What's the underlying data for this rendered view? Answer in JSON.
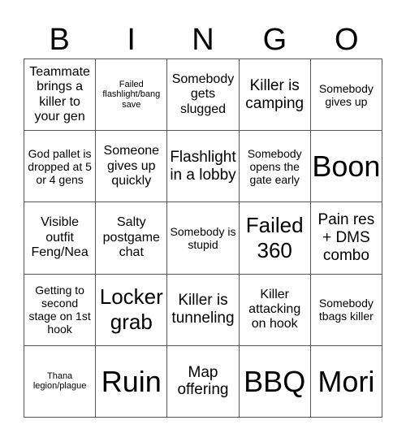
{
  "header": [
    "B",
    "I",
    "N",
    "G",
    "O"
  ],
  "cells": [
    {
      "text": "Teammate brings a killer to your gen",
      "size": "m"
    },
    {
      "text": "Failed flashlight/bang save",
      "size": "xs"
    },
    {
      "text": "Somebody gets slugged",
      "size": "m"
    },
    {
      "text": "Killer is camping",
      "size": "l"
    },
    {
      "text": "Somebody gives up",
      "size": "s"
    },
    {
      "text": "God pallet is dropped at 5 or 4 gens",
      "size": "s"
    },
    {
      "text": "Someone gives up quickly",
      "size": "m"
    },
    {
      "text": "Flashlight in a lobby",
      "size": "l"
    },
    {
      "text": "Somebody opens the gate early",
      "size": "s"
    },
    {
      "text": "Boon",
      "size": "xxl"
    },
    {
      "text": "Visible outfit Feng/Nea",
      "size": "m"
    },
    {
      "text": "Salty postgame chat",
      "size": "m"
    },
    {
      "text": "Somebody is stupid",
      "size": "s"
    },
    {
      "text": "Failed 360",
      "size": "xl"
    },
    {
      "text": "Pain res + DMS combo",
      "size": "l"
    },
    {
      "text": "Getting to second stage on 1st hook",
      "size": "s"
    },
    {
      "text": "Locker grab",
      "size": "xl"
    },
    {
      "text": "Killer is tunneling",
      "size": "l"
    },
    {
      "text": "Killer attacking on hook",
      "size": "m"
    },
    {
      "text": "Somebody tbags killer",
      "size": "s"
    },
    {
      "text": "Thana legion/plague",
      "size": "xs"
    },
    {
      "text": "Ruin",
      "size": "xxl"
    },
    {
      "text": "Map offering",
      "size": "l"
    },
    {
      "text": "BBQ",
      "size": "xxl"
    },
    {
      "text": "Mori",
      "size": "xxl"
    }
  ]
}
